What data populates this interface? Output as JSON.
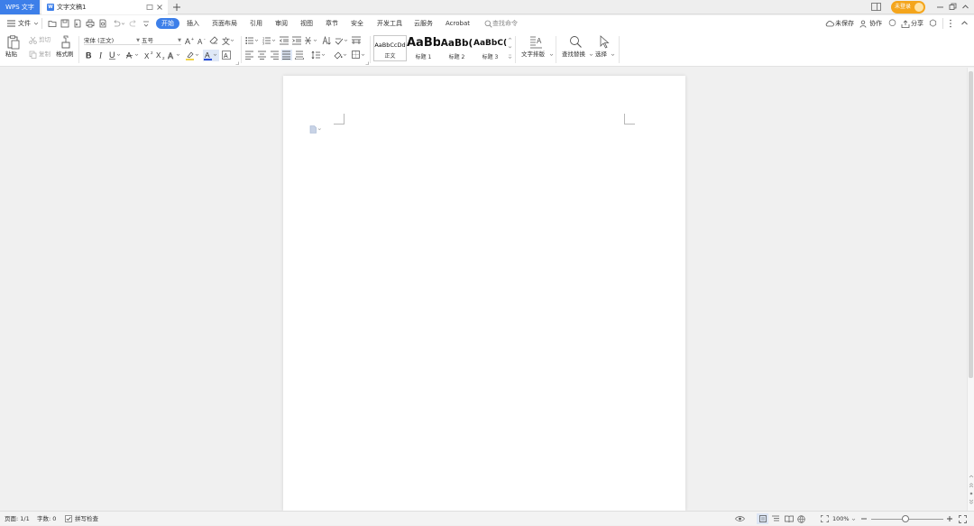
{
  "titlebar": {
    "app_tab": "WPS 文字",
    "doc_tab": "文字文稿1",
    "login_label": "未登录"
  },
  "menubar": {
    "file": "文件",
    "items": [
      "开始",
      "插入",
      "页面布局",
      "引用",
      "审阅",
      "视图",
      "章节",
      "安全",
      "开发工具",
      "云服务",
      "Acrobat"
    ],
    "search_placeholder": "查找命令",
    "unsaved": "未保存",
    "collab": "协作",
    "share": "分享"
  },
  "ribbon": {
    "paste": "粘贴",
    "cut": "剪切",
    "copy": "复制",
    "format_painter": "格式刷",
    "font_name": "宋体 (正文)",
    "font_size": "五号",
    "styles": [
      {
        "preview": "AaBbCcDd",
        "label": "正文"
      },
      {
        "preview": "AaBb",
        "label": "标题 1"
      },
      {
        "preview": "AaBb(",
        "label": "标题 2"
      },
      {
        "preview": "AaBbC(",
        "label": "标题 3"
      }
    ],
    "text_layout": "文字排版",
    "find_replace": "查找替换",
    "select": "选择"
  },
  "statusbar": {
    "page": "页面: 1/1",
    "word_count": "字数: 0",
    "spellcheck": "拼写检查",
    "zoom": "100%"
  },
  "colors": {
    "accent": "#3d7fe9",
    "login_bg": "#f4a51c",
    "highlight": "#f1d44b",
    "font_color": "#2b4fd6"
  }
}
